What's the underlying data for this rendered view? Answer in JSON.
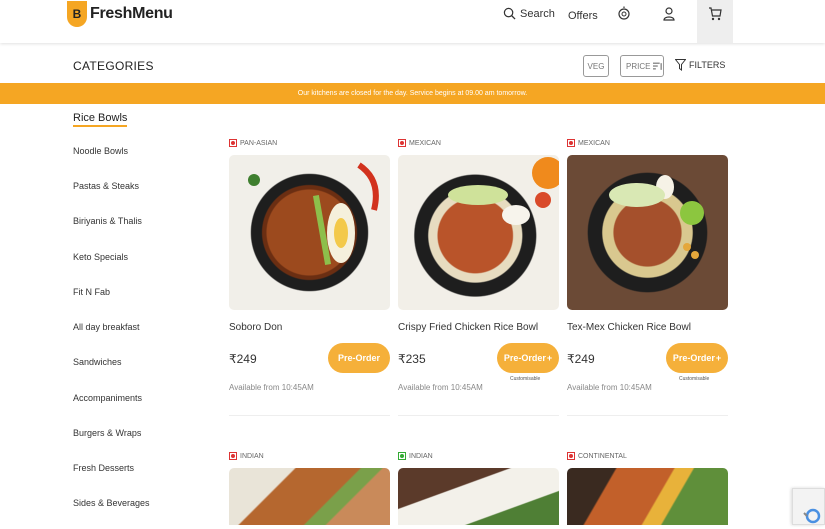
{
  "header": {
    "logo_text": "FreshMenu",
    "logo_mark": "B",
    "search_label": "Search",
    "offers_label": "Offers"
  },
  "catbar": {
    "title": "CATEGORIES",
    "veg_label": "VEG",
    "price_label": "PRICE",
    "filters_label": "FILTERS"
  },
  "banner": {
    "text": "Our kitchens are closed for the day. Service begins at 09.00 am tomorrow."
  },
  "sidebar": {
    "items": [
      {
        "label": "Rice Bowls"
      },
      {
        "label": "Noodle Bowls"
      },
      {
        "label": "Pastas & Steaks"
      },
      {
        "label": "Biriyanis & Thalis"
      },
      {
        "label": "Keto Specials"
      },
      {
        "label": "Fit N Fab"
      },
      {
        "label": "All day breakfast"
      },
      {
        "label": "Sandwiches"
      },
      {
        "label": "Accompaniments"
      },
      {
        "label": "Burgers & Wraps"
      },
      {
        "label": "Fresh Desserts"
      },
      {
        "label": "Sides & Beverages"
      }
    ]
  },
  "products": [
    {
      "cuisine": "PAN-ASIAN",
      "name": "Soboro Don",
      "price": "₹249",
      "cta": "Pre-Order",
      "plus": "",
      "customisable": "",
      "availability": "Available from 10:45AM",
      "veg": false
    },
    {
      "cuisine": "MEXICAN",
      "name": "Crispy Fried Chicken Rice Bowl",
      "price": "₹235",
      "cta": "Pre-Order",
      "plus": "+",
      "customisable": "Customisable",
      "availability": "Available from 10:45AM",
      "veg": false
    },
    {
      "cuisine": "MEXICAN",
      "name": "Tex-Mex Chicken Rice Bowl",
      "price": "₹249",
      "cta": "Pre-Order",
      "plus": "+",
      "customisable": "Customisable",
      "availability": "Available from 10:45AM",
      "veg": false
    },
    {
      "cuisine": "INDIAN",
      "veg": false
    },
    {
      "cuisine": "INDIAN",
      "veg": true
    },
    {
      "cuisine": "CONTINENTAL",
      "veg": false
    }
  ],
  "colors": {
    "accent": "#f5a623",
    "button": "#f5b03a",
    "nonveg": "#dd3333",
    "veg": "#33aa33"
  }
}
